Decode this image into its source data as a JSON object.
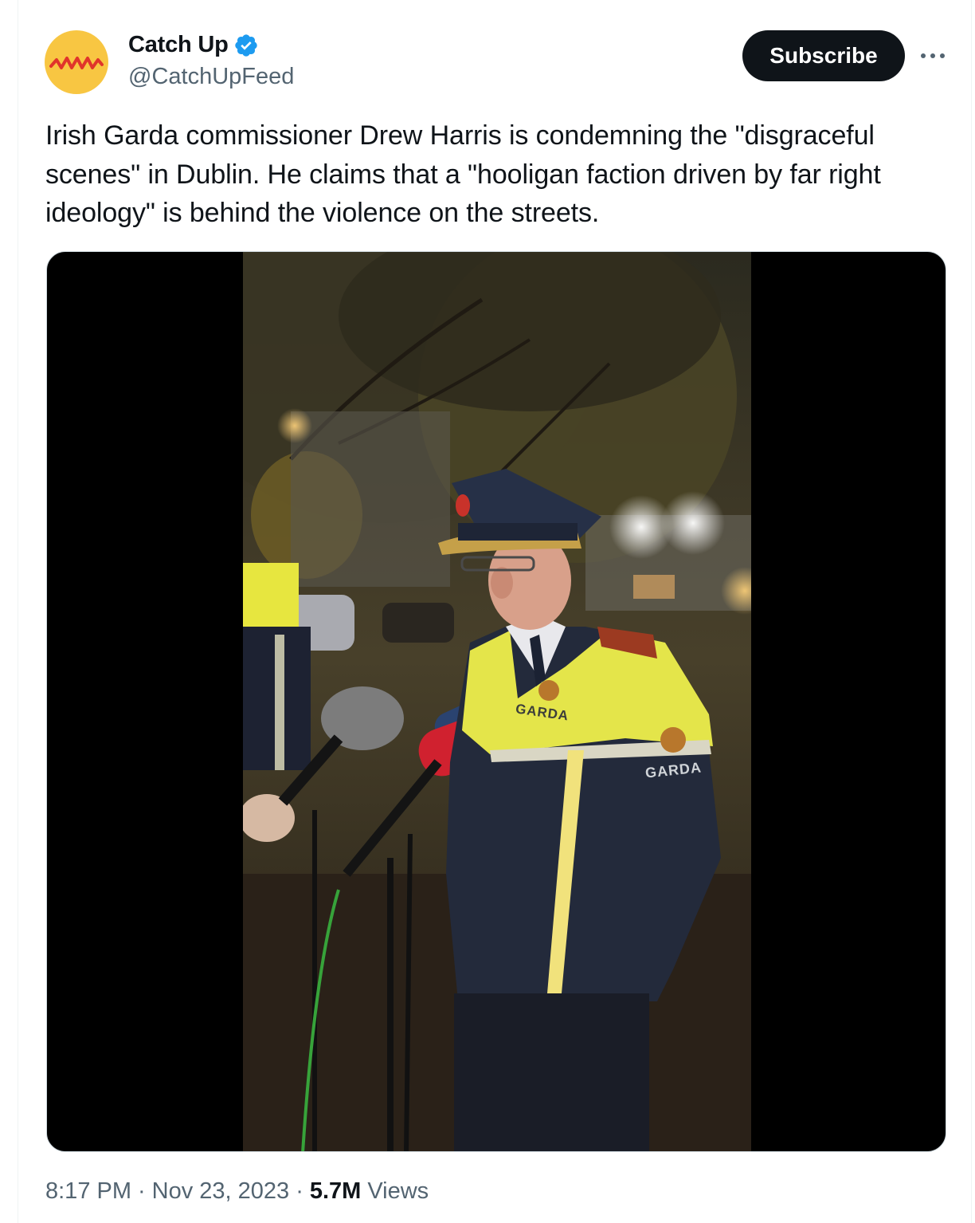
{
  "author": {
    "display_name": "Catch Up",
    "handle": "@CatchUpFeed",
    "verified": true,
    "avatar_color": "#f8c642",
    "avatar_icon": "waveform-logo"
  },
  "actions": {
    "subscribe_label": "Subscribe",
    "more_icon": "more-dots-icon"
  },
  "tweet": {
    "text": "Irish Garda commissioner Drew Harris is condemning the \"disgraceful scenes\" in Dublin. He claims that a \"hooligan faction driven by far right ideology\" is behind the violence on the streets."
  },
  "media": {
    "type": "video",
    "jacket_texts": [
      "GARDA",
      "GARDA"
    ]
  },
  "meta": {
    "time": "8:17 PM",
    "separator": "·",
    "date": "Nov 23, 2023",
    "views_count": "5.7M",
    "views_label": "Views"
  },
  "colors": {
    "accent_verified": "#1d9bf0",
    "subscribe_bg": "#0f1419",
    "secondary_text": "#536471"
  }
}
